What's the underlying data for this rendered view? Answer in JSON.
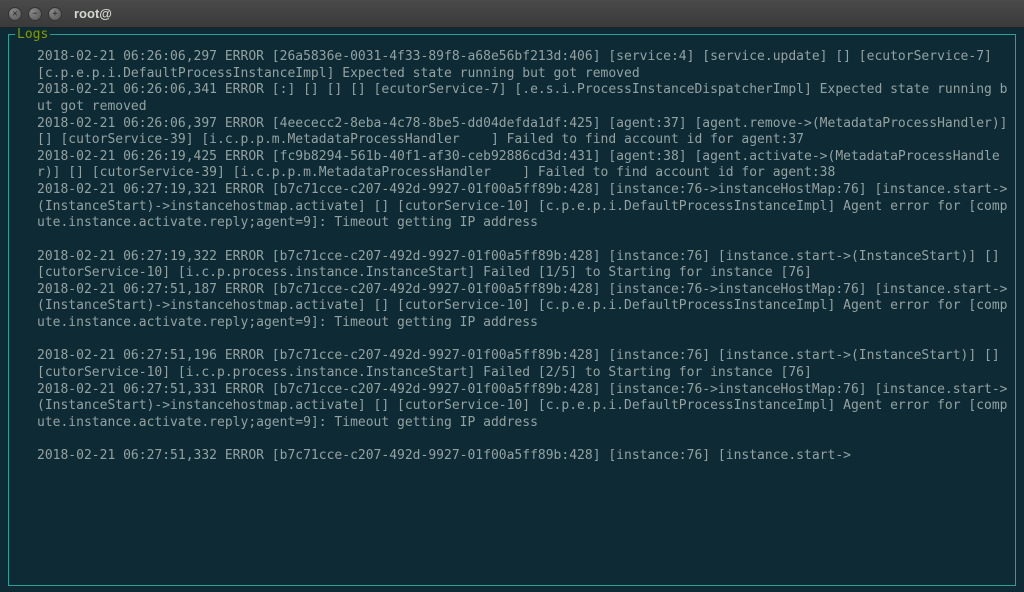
{
  "titlebar": {
    "title": "root@"
  },
  "panel": {
    "label": "Logs"
  },
  "logs": {
    "lines": [
      "2018-02-21 06:26:06,297 ERROR [26a5836e-0031-4f33-89f8-a68e56bf213d:406] [service:4] [service.update] [] [ecutorService-7] [c.p.e.p.i.DefaultProcessInstanceImpl] Expected state running but got removed",
      "2018-02-21 06:26:06,341 ERROR [:] [] [] [] [ecutorService-7] [.e.s.i.ProcessInstanceDispatcherImpl] Expected state running but got removed",
      "2018-02-21 06:26:06,397 ERROR [4eececc2-8eba-4c78-8be5-dd04defda1df:425] [agent:37] [agent.remove->(MetadataProcessHandler)] [] [cutorService-39] [i.c.p.p.m.MetadataProcessHandler    ] Failed to find account id for agent:37",
      "2018-02-21 06:26:19,425 ERROR [fc9b8294-561b-40f1-af30-ceb92886cd3d:431] [agent:38] [agent.activate->(MetadataProcessHandler)] [] [cutorService-39] [i.c.p.p.m.MetadataProcessHandler    ] Failed to find account id for agent:38",
      "2018-02-21 06:27:19,321 ERROR [b7c71cce-c207-492d-9927-01f00a5ff89b:428] [instance:76->instanceHostMap:76] [instance.start->(InstanceStart)->instancehostmap.activate] [] [cutorService-10] [c.p.e.p.i.DefaultProcessInstanceImpl] Agent error for [compute.instance.activate.reply;agent=9]: Timeout getting IP address",
      "",
      "2018-02-21 06:27:19,322 ERROR [b7c71cce-c207-492d-9927-01f00a5ff89b:428] [instance:76] [instance.start->(InstanceStart)] [] [cutorService-10] [i.c.p.process.instance.InstanceStart] Failed [1/5] to Starting for instance [76]",
      "2018-02-21 06:27:51,187 ERROR [b7c71cce-c207-492d-9927-01f00a5ff89b:428] [instance:76->instanceHostMap:76] [instance.start->(InstanceStart)->instancehostmap.activate] [] [cutorService-10] [c.p.e.p.i.DefaultProcessInstanceImpl] Agent error for [compute.instance.activate.reply;agent=9]: Timeout getting IP address",
      "",
      "2018-02-21 06:27:51,196 ERROR [b7c71cce-c207-492d-9927-01f00a5ff89b:428] [instance:76] [instance.start->(InstanceStart)] [] [cutorService-10] [i.c.p.process.instance.InstanceStart] Failed [2/5] to Starting for instance [76]",
      "2018-02-21 06:27:51,331 ERROR [b7c71cce-c207-492d-9927-01f00a5ff89b:428] [instance:76->instanceHostMap:76] [instance.start->(InstanceStart)->instancehostmap.activate] [] [cutorService-10] [c.p.e.p.i.DefaultProcessInstanceImpl] Agent error for [compute.instance.activate.reply;agent=9]: Timeout getting IP address",
      "",
      "2018-02-21 06:27:51,332 ERROR [b7c71cce-c207-492d-9927-01f00a5ff89b:428] [instance:76] [instance.start->"
    ]
  }
}
